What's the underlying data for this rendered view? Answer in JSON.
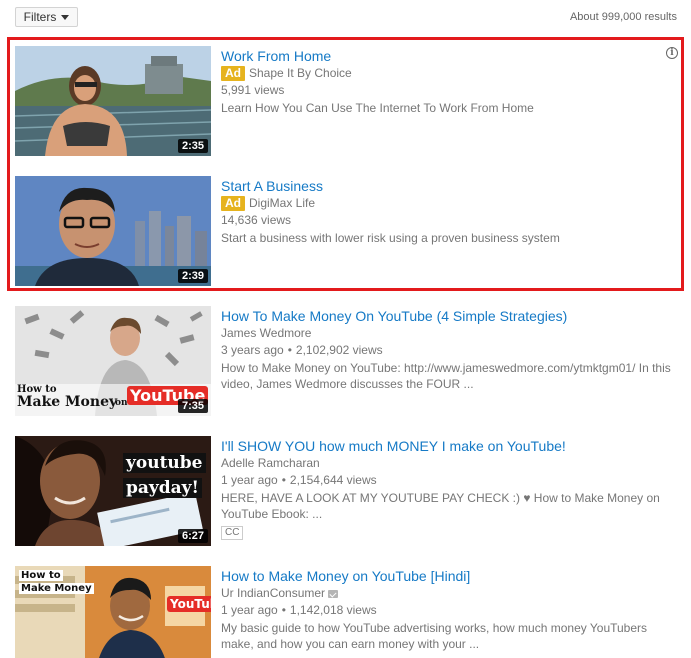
{
  "toolbar": {
    "filters_label": "Filters",
    "results_count": "About 999,000 results"
  },
  "ads": [
    {
      "title": "Work From Home",
      "badge": "Ad",
      "channel": "Shape It By Choice",
      "views": "5,991 views",
      "description": "Learn How You Can Use The Internet To Work From Home",
      "duration": "2:35"
    },
    {
      "title": "Start A Business",
      "badge": "Ad",
      "channel": "DigiMax Life",
      "views": "14,636 views",
      "description": "Start a business with lower risk using a proven business system",
      "duration": "2:39"
    }
  ],
  "results": [
    {
      "title": "How To Make Money On YouTube (4 Simple Strategies)",
      "channel": "James Wedmore",
      "age": "3 years ago",
      "separator": "•",
      "views": "2,102,902 views",
      "description": "How to Make Money on YouTube: http://www.jameswedmore.com/ytmktgm01/ In this video, James Wedmore discusses the FOUR ...",
      "duration": "7:35",
      "thumb_text_1": "How to",
      "thumb_text_2": "Make Money",
      "thumb_text_3": "on",
      "thumb_text_4": "YouTube"
    },
    {
      "title": "I'll SHOW YOU how much MONEY I make on YouTube!",
      "channel": "Adelle Ramcharan",
      "age": "1 year ago",
      "separator": "•",
      "views": "2,154,644 views",
      "description": "HERE, HAVE A LOOK AT MY YOUTUBE PAY CHECK :) ♥ How to Make Money on YouTube Ebook: ...",
      "badge": "CC",
      "duration": "6:27",
      "thumb_text_1": "youtube",
      "thumb_text_2": "payday!"
    },
    {
      "title": "How to Make Money on YouTube [Hindi]",
      "channel": "Ur IndianConsumer",
      "age": "1 year ago",
      "separator": "•",
      "views": "1,142,018 views",
      "description": "My basic guide to how YouTube advertising works, how much money YouTubers make, and how you can earn money with your ...",
      "thumb_text_1": "How to",
      "thumb_text_2": "Make Money",
      "thumb_text_3": "YouTube"
    }
  ]
}
